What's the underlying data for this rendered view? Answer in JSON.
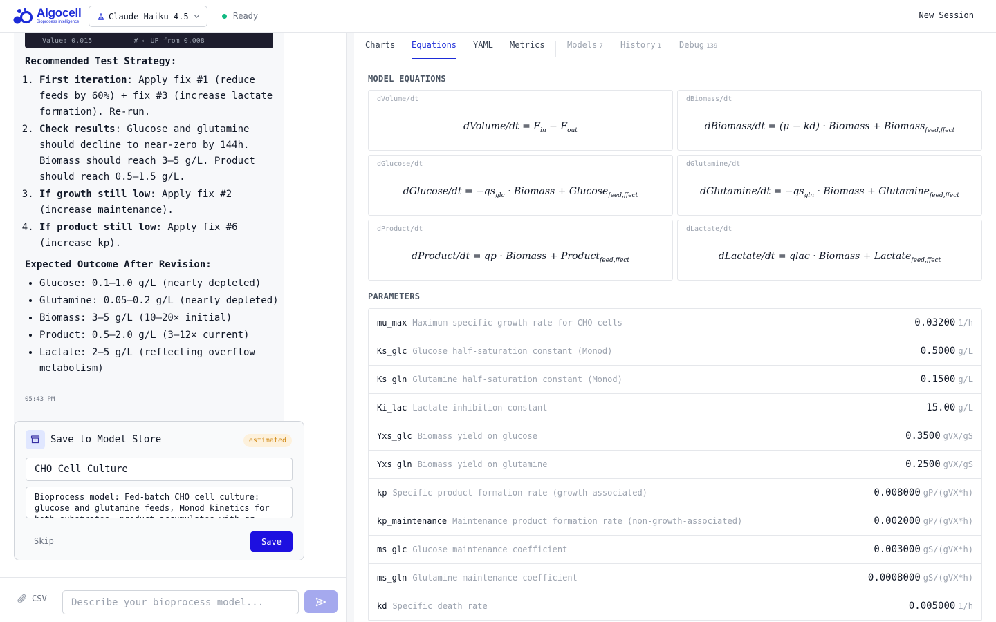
{
  "header": {
    "logo_name": "Algocell",
    "logo_tag": "Bioprocess intelligence",
    "model": "Claude Haiku 4.5",
    "status": "Ready",
    "new_session": "New Session"
  },
  "chat": {
    "code_tail": "Value: 0.015          # ← UP from 0.008",
    "strategy_heading": "Recommended Test Strategy:",
    "steps": [
      {
        "bold": "First iteration",
        "text": ": Apply fix #1 (reduce feeds by 60%) + fix #3 (increase lactate formation). Re-run."
      },
      {
        "bold": "Check results",
        "text": ": Glucose and glutamine should decline to near-zero by 144h. Biomass should reach 3–5 g/L. Product should reach 0.5–1.5 g/L."
      },
      {
        "bold": "If growth still low",
        "text": ": Apply fix #2 (increase maintenance)."
      },
      {
        "bold": "If product still low",
        "text": ": Apply fix #6 (increase kp)."
      }
    ],
    "outcome_heading": "Expected Outcome After Revision:",
    "outcomes": [
      "Glucose: 0.1–1.0 g/L (nearly depleted)",
      "Glutamine: 0.05–0.2 g/L (nearly depleted)",
      "Biomass: 3–5 g/L (10–20× initial)",
      "Product: 0.5–2.0 g/L (3–12× current)",
      "Lactate: 2–5 g/L (reflecting overflow metabolism)"
    ],
    "timestamp": "05:43 PM"
  },
  "save_card": {
    "title": "Save to Model Store",
    "badge": "estimated",
    "name_value": "CHO Cell Culture",
    "description_value": "Bioprocess model: Fed-batch CHO cell culture: glucose and glutamine feeds, Monod kinetics for both substrates, product accumulates with gr",
    "skip": "Skip",
    "save": "Save"
  },
  "composer": {
    "attach_label": "CSV",
    "placeholder": "Describe your bioprocess model..."
  },
  "tabs": [
    {
      "label": "Charts",
      "count": ""
    },
    {
      "label": "Equations",
      "count": ""
    },
    {
      "label": "YAML",
      "count": ""
    },
    {
      "label": "Metrics",
      "count": ""
    },
    {
      "label": "Models",
      "count": "7"
    },
    {
      "label": "History",
      "count": "1"
    },
    {
      "label": "Debug",
      "count": "139"
    }
  ],
  "equations_label": "MODEL EQUATIONS",
  "equations": [
    {
      "label": "dVolume/dt"
    },
    {
      "label": "dBiomass/dt"
    },
    {
      "label": "dGlucose/dt"
    },
    {
      "label": "dGlutamine/dt"
    },
    {
      "label": "dProduct/dt"
    },
    {
      "label": "dLactate/dt"
    }
  ],
  "parameters_label": "PARAMETERS",
  "parameters": [
    {
      "name": "mu_max",
      "desc": "Maximum specific growth rate for CHO cells",
      "value": "0.03200",
      "unit": "1/h"
    },
    {
      "name": "Ks_glc",
      "desc": "Glucose half-saturation constant (Monod)",
      "value": "0.5000",
      "unit": "g/L"
    },
    {
      "name": "Ks_gln",
      "desc": "Glutamine half-saturation constant (Monod)",
      "value": "0.1500",
      "unit": "g/L"
    },
    {
      "name": "Ki_lac",
      "desc": "Lactate inhibition constant",
      "value": "15.00",
      "unit": "g/L"
    },
    {
      "name": "Yxs_glc",
      "desc": "Biomass yield on glucose",
      "value": "0.3500",
      "unit": "gVX/gS"
    },
    {
      "name": "Yxs_gln",
      "desc": "Biomass yield on glutamine",
      "value": "0.2500",
      "unit": "gVX/gS"
    },
    {
      "name": "kp",
      "desc": "Specific product formation rate (growth-associated)",
      "value": "0.008000",
      "unit": "gP/(gVX*h)"
    },
    {
      "name": "kp_maintenance",
      "desc": "Maintenance product formation rate (non-growth-associated)",
      "value": "0.002000",
      "unit": "gP/(gVX*h)"
    },
    {
      "name": "ms_glc",
      "desc": "Glucose maintenance coefficient",
      "value": "0.003000",
      "unit": "gS/(gVX*h)"
    },
    {
      "name": "ms_gln",
      "desc": "Glutamine maintenance coefficient",
      "value": "0.0008000",
      "unit": "gS/(gVX*h)"
    },
    {
      "name": "kd",
      "desc": "Specific death rate",
      "value": "0.005000",
      "unit": "1/h"
    }
  ],
  "colors": {
    "brand": "#1d2cd8",
    "save_button": "#1d10e0",
    "status_ready": "#10b981",
    "badge_text": "#d28a16"
  },
  "icons": [
    "logo-icon",
    "flask-icon",
    "chevron-down-icon",
    "archive-icon",
    "paperclip-icon",
    "send-icon"
  ]
}
